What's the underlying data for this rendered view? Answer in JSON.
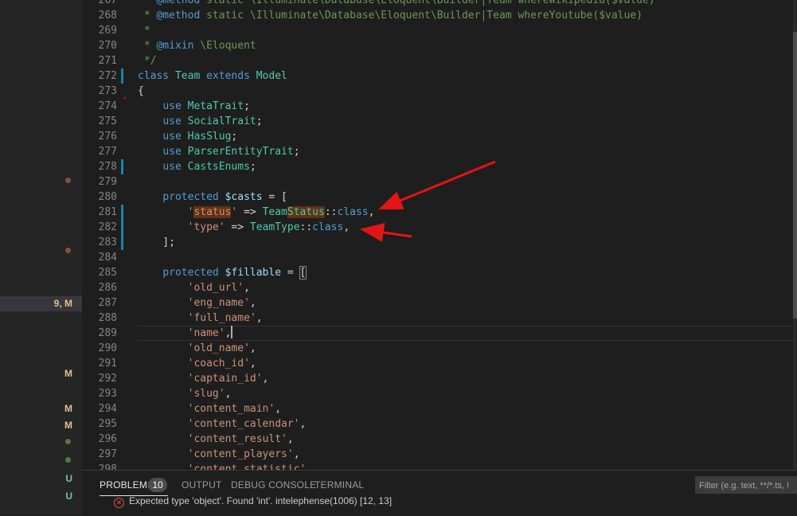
{
  "sidebar": {
    "items": [
      {
        "kind": "badge",
        "text": "9, M",
        "color": "#e2c08d",
        "selected": true,
        "row": 0
      },
      {
        "kind": "letter",
        "text": "M",
        "color": "#e2c08d"
      },
      {
        "kind": "letter",
        "text": "M",
        "color": "#e2c08d"
      },
      {
        "kind": "letter",
        "text": "M",
        "color": "#e2c08d"
      },
      {
        "kind": "letter",
        "text": "U",
        "color": "#73c991"
      },
      {
        "kind": "letter",
        "text": "U",
        "color": "#73c991"
      }
    ]
  },
  "editor": {
    "lines": [
      {
        "n": "267",
        "t": " * @method static \\Illuminate\\Database\\Eloquent\\Builder|Team whereWikipedia($value)"
      },
      {
        "n": "268",
        "t": " * @method static \\Illuminate\\Database\\Eloquent\\Builder|Team whereYoutube($value)"
      },
      {
        "n": "269",
        "t": " *"
      },
      {
        "n": "270",
        "t": " * @mixin \\Eloquent"
      },
      {
        "n": "271",
        "t": " */"
      },
      {
        "n": "272",
        "t": "class Team extends Model"
      },
      {
        "n": "273",
        "t": "{"
      },
      {
        "n": "274",
        "t": "    use MetaTrait;"
      },
      {
        "n": "275",
        "t": "    use SocialTrait;"
      },
      {
        "n": "276",
        "t": "    use HasSlug;"
      },
      {
        "n": "277",
        "t": "    use ParserEntityTrait;"
      },
      {
        "n": "278",
        "t": "    use CastsEnums;"
      },
      {
        "n": "279",
        "t": ""
      },
      {
        "n": "280",
        "t": "    protected $casts = ["
      },
      {
        "n": "281",
        "t": "        'status' => TeamStatus::class,"
      },
      {
        "n": "282",
        "t": "        'type' => TeamType::class,"
      },
      {
        "n": "283",
        "t": "    ];"
      },
      {
        "n": "284",
        "t": ""
      },
      {
        "n": "285",
        "t": "    protected $fillable = ["
      },
      {
        "n": "286",
        "t": "        'old_url',"
      },
      {
        "n": "287",
        "t": "        'eng_name',"
      },
      {
        "n": "288",
        "t": "        'full_name',"
      },
      {
        "n": "289",
        "t": "        'name',"
      },
      {
        "n": "290",
        "t": "        'old_name',"
      },
      {
        "n": "291",
        "t": "        'coach_id',"
      },
      {
        "n": "292",
        "t": "        'captain_id',"
      },
      {
        "n": "293",
        "t": "        'slug',"
      },
      {
        "n": "294",
        "t": "        'content_main',"
      },
      {
        "n": "295",
        "t": "        'content_calendar',"
      },
      {
        "n": "296",
        "t": "        'content_result',"
      },
      {
        "n": "297",
        "t": "        'content_players',"
      },
      {
        "n": "298",
        "t": "        'content_statistic',"
      }
    ]
  },
  "panel": {
    "tabs": [
      {
        "label": "PROBLEMS",
        "active": true
      },
      {
        "label": "OUTPUT",
        "active": false
      },
      {
        "label": "DEBUG CONSOLE",
        "active": false
      },
      {
        "label": "TERMINAL",
        "active": false
      }
    ],
    "problems_count": "10",
    "filter_placeholder": "Filter (e.g. text, **/*.ts, !",
    "problem_message": "Expected type 'object'. Found 'int'. intelephense(1006)  [12, 13]"
  },
  "colors": {
    "accent": "#007acc",
    "annotation_arrow": "#e51414",
    "modified": "#e2c08d",
    "untracked": "#73c991"
  }
}
